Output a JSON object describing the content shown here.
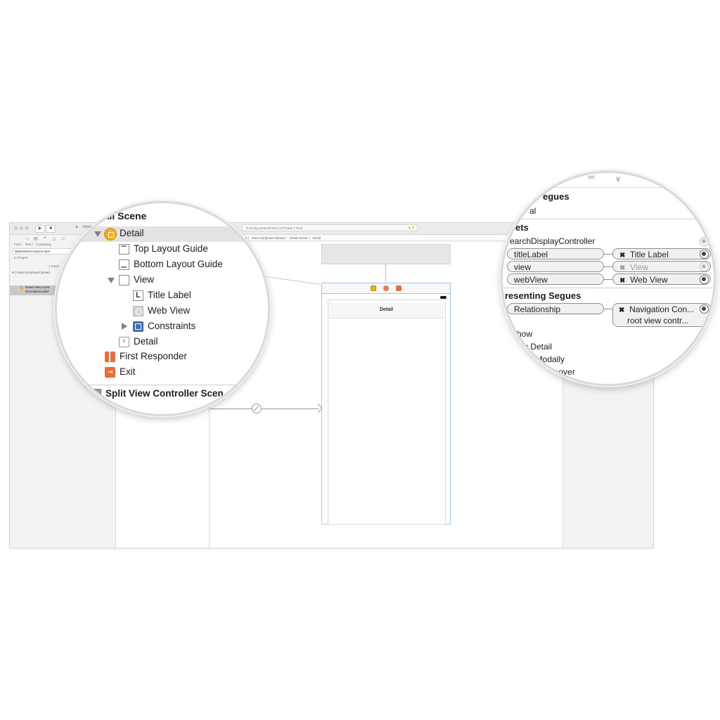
{
  "window": {
    "scheme": "IntranetCl",
    "run_status": "Running IntranetClient on iPhone 7 Plus",
    "warning_count": "▲ 9",
    "jump_bar": "ient 〉 Main.storyboard (Base) 〉 Detail Scene 〉 Detail"
  },
  "navigator": {
    "filter_tabs": "Find 〉 Text 〉 Containing",
    "search_value": "Q▾detailDescriptionLabel",
    "scope": "In Project",
    "result_count": "1 result",
    "file_row": "Main.storyboard (Base)",
    "result_row_1": "Detail View Contr",
    "result_row_2": "DescriptionLabel"
  },
  "canvas": {
    "nav_title": "Detail"
  },
  "outline": {
    "scene_title": "tail Scene",
    "items": [
      {
        "label": "Detail"
      },
      {
        "label": "Top Layout Guide"
      },
      {
        "label": "Bottom Layout Guide"
      },
      {
        "label": "View"
      },
      {
        "label": "Title Label"
      },
      {
        "label": "Web View"
      },
      {
        "label": "Constraints"
      },
      {
        "label": "Detail"
      },
      {
        "label": "First Responder"
      },
      {
        "label": "Exit"
      }
    ],
    "title_label_glyph": "L",
    "next_scene": "Split View Controller Scen"
  },
  "connections": {
    "top_value": "ool",
    "triggered_segues_header": "egues",
    "triggered_segue_item": "al",
    "outlets_header": "ets",
    "search_display": "earchDisplayController",
    "outlets": [
      {
        "name": "titleLabel",
        "target": "Title Label",
        "connected": true
      },
      {
        "name": "view",
        "target": "View",
        "connected": false
      },
      {
        "name": "webView",
        "target": "Web View",
        "connected": true
      }
    ],
    "presenting_header": "resenting Segues",
    "relationship": {
      "name": "Relationship",
      "target_line1": "Navigation Con...",
      "target_line2": "root view contr..."
    },
    "segue_items": [
      "how",
      "y Detail",
      "t Modally",
      "Popover"
    ],
    "x_glyph": "✖"
  }
}
